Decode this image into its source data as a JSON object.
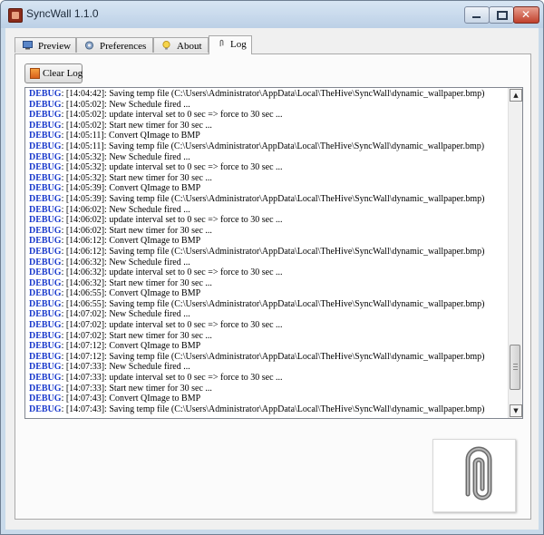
{
  "window": {
    "title": "SyncWall 1.1.0",
    "close_glyph": "✕"
  },
  "tabs": [
    {
      "label": "Preview",
      "icon": "monitor-icon"
    },
    {
      "label": "Preferences",
      "icon": "gear-icon"
    },
    {
      "label": "About",
      "icon": "lightbulb-icon"
    },
    {
      "label": "Log",
      "icon": "paperclip-icon",
      "active": true
    }
  ],
  "toolbar": {
    "clear_label": "Clear Log",
    "clear_icon": "bucket-icon"
  },
  "log": {
    "level_color": "#1a3acc",
    "entries": [
      {
        "level": "DEBUG",
        "text": ": [14:04:42]: Saving temp file (C:\\Users\\Administrator\\AppData\\Local\\TheHive\\SyncWall\\dynamic_wallpaper.bmp)"
      },
      {
        "level": "DEBUG",
        "text": ": [14:05:02]: New Schedule fired ..."
      },
      {
        "level": "DEBUG",
        "text": ": [14:05:02]: update interval set to 0 sec => force to 30 sec ..."
      },
      {
        "level": "DEBUG",
        "text": ": [14:05:02]: Start new timer for 30 sec ..."
      },
      {
        "level": "DEBUG",
        "text": ": [14:05:11]: Convert QImage to BMP"
      },
      {
        "level": "DEBUG",
        "text": ": [14:05:11]: Saving temp file (C:\\Users\\Administrator\\AppData\\Local\\TheHive\\SyncWall\\dynamic_wallpaper.bmp)"
      },
      {
        "level": "DEBUG",
        "text": ": [14:05:32]: New Schedule fired ..."
      },
      {
        "level": "DEBUG",
        "text": ": [14:05:32]: update interval set to 0 sec => force to 30 sec ..."
      },
      {
        "level": "DEBUG",
        "text": ": [14:05:32]: Start new timer for 30 sec ..."
      },
      {
        "level": "DEBUG",
        "text": ": [14:05:39]: Convert QImage to BMP"
      },
      {
        "level": "DEBUG",
        "text": ": [14:05:39]: Saving temp file (C:\\Users\\Administrator\\AppData\\Local\\TheHive\\SyncWall\\dynamic_wallpaper.bmp)"
      },
      {
        "level": "DEBUG",
        "text": ": [14:06:02]: New Schedule fired ..."
      },
      {
        "level": "DEBUG",
        "text": ": [14:06:02]: update interval set to 0 sec => force to 30 sec ..."
      },
      {
        "level": "DEBUG",
        "text": ": [14:06:02]: Start new timer for 30 sec ..."
      },
      {
        "level": "DEBUG",
        "text": ": [14:06:12]: Convert QImage to BMP"
      },
      {
        "level": "DEBUG",
        "text": ": [14:06:12]: Saving temp file (C:\\Users\\Administrator\\AppData\\Local\\TheHive\\SyncWall\\dynamic_wallpaper.bmp)"
      },
      {
        "level": "DEBUG",
        "text": ": [14:06:32]: New Schedule fired ..."
      },
      {
        "level": "DEBUG",
        "text": ": [14:06:32]: update interval set to 0 sec => force to 30 sec ..."
      },
      {
        "level": "DEBUG",
        "text": ": [14:06:32]: Start new timer for 30 sec ..."
      },
      {
        "level": "DEBUG",
        "text": ": [14:06:55]: Convert QImage to BMP"
      },
      {
        "level": "DEBUG",
        "text": ": [14:06:55]: Saving temp file (C:\\Users\\Administrator\\AppData\\Local\\TheHive\\SyncWall\\dynamic_wallpaper.bmp)"
      },
      {
        "level": "DEBUG",
        "text": ": [14:07:02]: New Schedule fired ..."
      },
      {
        "level": "DEBUG",
        "text": ": [14:07:02]: update interval set to 0 sec => force to 30 sec ..."
      },
      {
        "level": "DEBUG",
        "text": ": [14:07:02]: Start new timer for 30 sec ..."
      },
      {
        "level": "DEBUG",
        "text": ": [14:07:12]: Convert QImage to BMP"
      },
      {
        "level": "DEBUG",
        "text": ": [14:07:12]: Saving temp file (C:\\Users\\Administrator\\AppData\\Local\\TheHive\\SyncWall\\dynamic_wallpaper.bmp)"
      },
      {
        "level": "DEBUG",
        "text": ": [14:07:33]: New Schedule fired ..."
      },
      {
        "level": "DEBUG",
        "text": ": [14:07:33]: update interval set to 0 sec => force to 30 sec ..."
      },
      {
        "level": "DEBUG",
        "text": ": [14:07:33]: Start new timer for 30 sec ..."
      },
      {
        "level": "DEBUG",
        "text": ": [14:07:43]: Convert QImage to BMP"
      },
      {
        "level": "DEBUG",
        "text": ": [14:07:43]: Saving temp file (C:\\Users\\Administrator\\AppData\\Local\\TheHive\\SyncWall\\dynamic_wallpaper.bmp)"
      }
    ]
  },
  "scrollbar": {
    "up_glyph": "▲",
    "down_glyph": "▼"
  },
  "attachment": {
    "icon": "paperclip-icon"
  }
}
